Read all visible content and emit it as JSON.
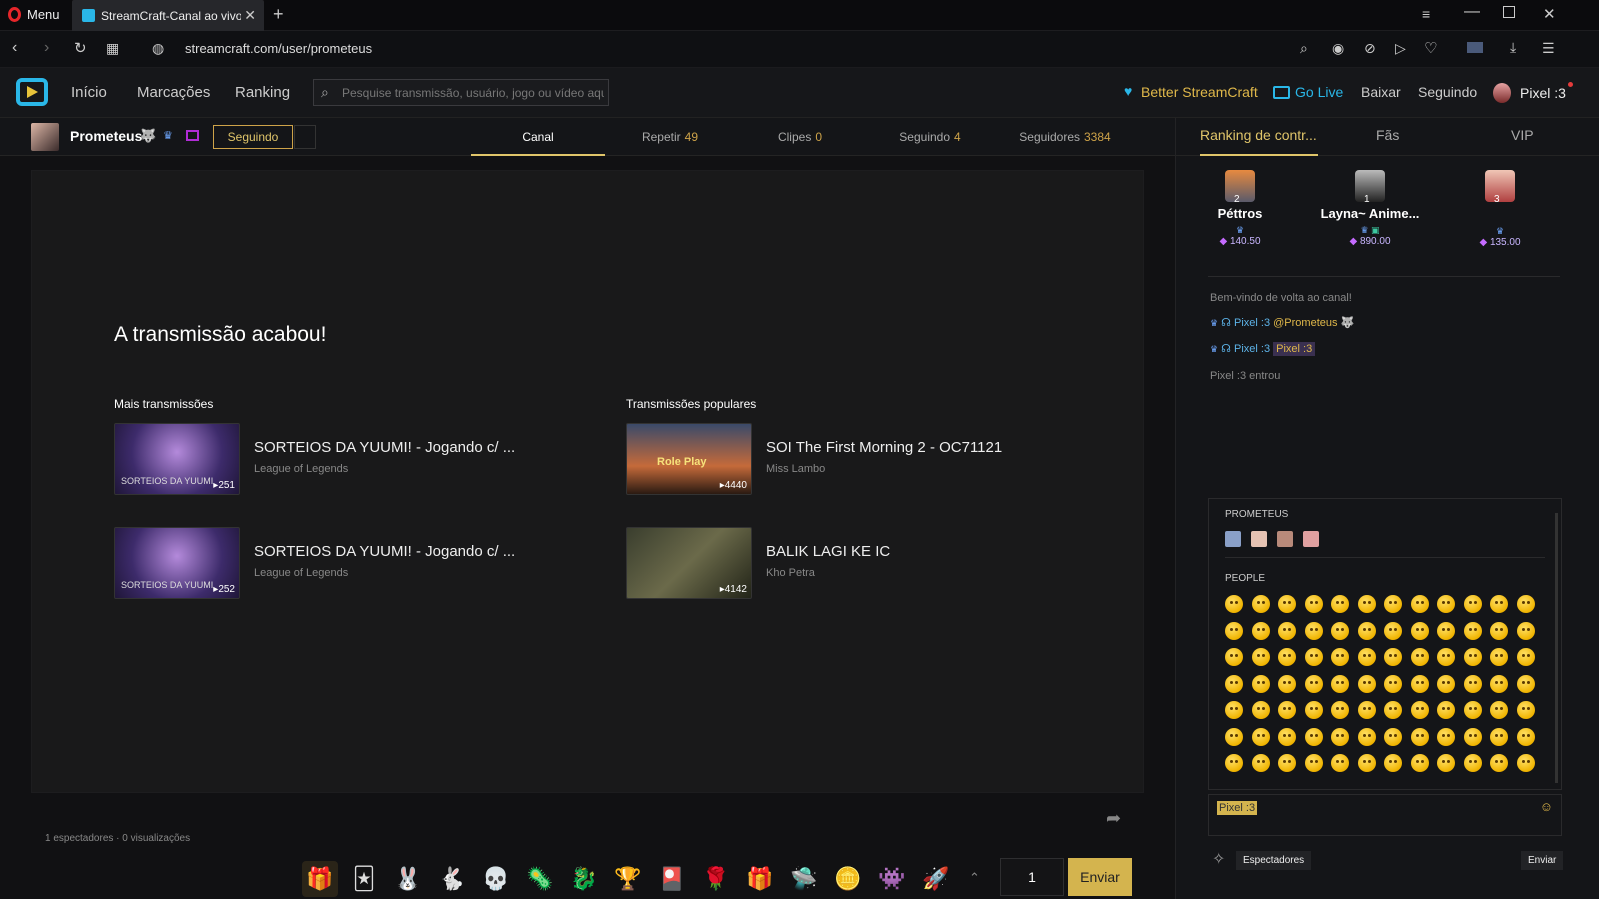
{
  "browser": {
    "menu_label": "Menu",
    "tab_title": "StreamCraft-Canal ao vivo",
    "url": "streamcraft.com/user/prometeus"
  },
  "header": {
    "nav": [
      "Início",
      "Marcações",
      "Ranking"
    ],
    "search_placeholder": "Pesquise transmissão, usuário, jogo ou vídeo aqui",
    "better_streamcraft": "Better StreamCraft",
    "go_live": "Go Live",
    "download": "Baixar",
    "following": "Seguindo",
    "username": "Pixel :3"
  },
  "channel": {
    "name": "Prometeus",
    "follow_button": "Seguindo",
    "tabs": [
      {
        "label": "Canal",
        "count": ""
      },
      {
        "label": "Repetir",
        "count": "49"
      },
      {
        "label": "Clipes",
        "count": "0"
      },
      {
        "label": "Seguindo",
        "count": "4"
      },
      {
        "label": "Seguidores",
        "count": "3384"
      }
    ]
  },
  "player": {
    "ended_title": "A transmissão acabou!",
    "more_streams_heading": "Mais transmissões",
    "popular_streams_heading": "Transmissões populares",
    "more_streams": [
      {
        "title": "SORTEIOS DA YUUMI! - Jogando c/ ...",
        "subtitle": "League of Legends",
        "count": "251",
        "thumb_text": "SORTEIOS DA YUUMI"
      },
      {
        "title": "SORTEIOS DA YUUMI! - Jogando c/ ...",
        "subtitle": "League of Legends",
        "count": "252",
        "thumb_text": "SORTEIOS DA YUUMI"
      }
    ],
    "popular_streams": [
      {
        "title": "SOI The First Morning 2 - OC71121",
        "subtitle": "Miss Lambo",
        "count": "4440",
        "thumb_text": "Role Play"
      },
      {
        "title": "BALIK LAGI KE IC",
        "subtitle": "Kho Petra",
        "count": "4142",
        "thumb_text": ""
      }
    ],
    "viewers": "1 espectadores",
    "views": "0 visualizações",
    "gift_quantity": "1",
    "send_label": "Enviar"
  },
  "right_panel": {
    "tabs": [
      "Ranking de contr...",
      "Fãs",
      "VIP"
    ],
    "ranking": [
      {
        "rank": "2",
        "name": "Péttros",
        "amount": "140.50"
      },
      {
        "rank": "1",
        "name": "Layna~ Anime...",
        "amount": "890.00"
      },
      {
        "rank": "3",
        "name": "",
        "amount": "135.00"
      }
    ],
    "chat": {
      "welcome": "Bem-vindo de volta ao canal!",
      "messages": [
        {
          "user": "Pixel :3",
          "text": "@Prometeus"
        },
        {
          "user": "Pixel :3",
          "text": "Pixel :3"
        }
      ],
      "entered": "Pixel :3 entrou",
      "input_value": "Pixel :3",
      "spectators_button": "Espectadores",
      "send_button": "Enviar"
    },
    "emoji_picker": {
      "section_channel": "PROMETEUS",
      "section_people": "PEOPLE"
    }
  },
  "colors": {
    "accent": "#e0c56a",
    "gold": "#cea349",
    "link_blue": "#5db3e8",
    "bg": "#111113"
  }
}
